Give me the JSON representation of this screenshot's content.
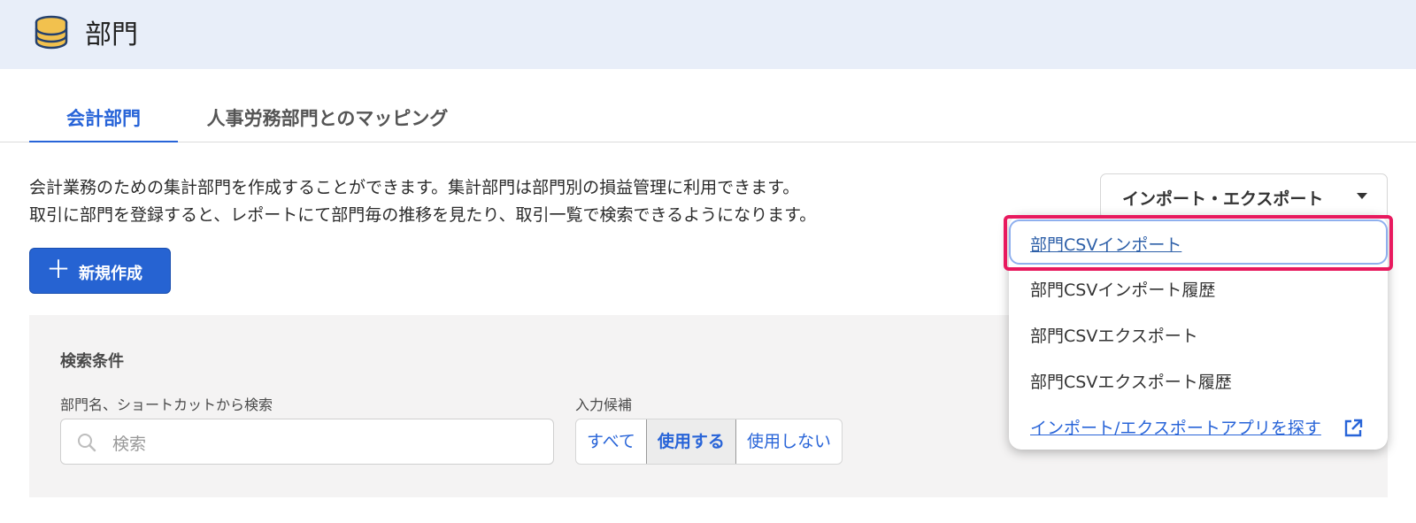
{
  "header": {
    "title": "部門",
    "icon": "database-icon"
  },
  "tabs": [
    {
      "label": "会計部門",
      "active": true
    },
    {
      "label": "人事労務部門とのマッピング",
      "active": false
    }
  ],
  "description": [
    "会計業務のための集計部門を作成することができます。集計部門は部門別の損益管理に利用できます。",
    "取引に部門を登録すると、レポートにて部門毎の推移を見たり、取引一覧で検索できるようになります。"
  ],
  "new_button": {
    "label": "新規作成",
    "icon": "plus-icon"
  },
  "search_panel": {
    "title": "検索条件",
    "name_label": "部門名、ショートカットから検索",
    "search_placeholder": "検索",
    "candidate_label": "入力候補",
    "candidate_options": [
      "すべて",
      "使用する",
      "使用しない"
    ],
    "candidate_selected": "使用する"
  },
  "import_export": {
    "label": "インポート・エクスポート",
    "menu": [
      "部門CSVインポート",
      "部門CSVインポート履歴",
      "部門CSVエクスポート",
      "部門CSVエクスポート履歴",
      "インポート/エクスポートアプリを探す"
    ]
  },
  "colors": {
    "accent": "#2864d8",
    "header_bg": "#e8eef9",
    "highlight": "#e8195e"
  }
}
